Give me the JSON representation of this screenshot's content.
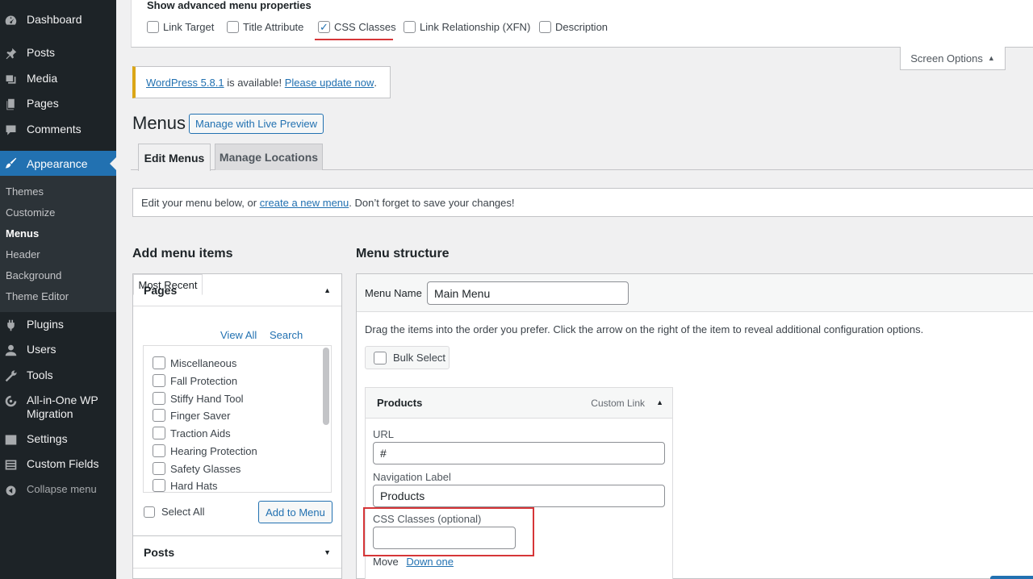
{
  "sidebar": {
    "items": [
      {
        "label": "Dashboard",
        "icon": "dashboard-icon"
      },
      {
        "label": "Posts",
        "icon": "pin-icon"
      },
      {
        "label": "Media",
        "icon": "media-icon"
      },
      {
        "label": "Pages",
        "icon": "pages-icon"
      },
      {
        "label": "Comments",
        "icon": "comments-icon"
      },
      {
        "label": "Appearance",
        "icon": "brush-icon"
      },
      {
        "label": "Plugins",
        "icon": "plugin-icon"
      },
      {
        "label": "Users",
        "icon": "user-icon"
      },
      {
        "label": "Tools",
        "icon": "wrench-icon"
      },
      {
        "label": "All-in-One WP",
        "label2": "Migration",
        "icon": "migration-icon"
      },
      {
        "label": "Settings",
        "icon": "settings-icon"
      },
      {
        "label": "Custom Fields",
        "icon": "fields-icon"
      }
    ],
    "submenu": [
      "Themes",
      "Customize",
      "Menus",
      "Header",
      "Background",
      "Theme Editor"
    ],
    "collapse_label": "Collapse menu"
  },
  "screen_options": {
    "legend": "Show advanced menu properties",
    "options": [
      {
        "label": "Link Target",
        "checked": false
      },
      {
        "label": "Title Attribute",
        "checked": false
      },
      {
        "label": "CSS Classes",
        "checked": true
      },
      {
        "label": "Link Relationship (XFN)",
        "checked": false
      },
      {
        "label": "Description",
        "checked": false
      }
    ],
    "tab_label": "Screen Options"
  },
  "update_notice": {
    "link1": "WordPress 5.8.1",
    "text": " is available! ",
    "link2": "Please update now",
    "end": "."
  },
  "page": {
    "title": "Menus",
    "live_preview": "Manage with Live Preview",
    "tabs": [
      "Edit Menus",
      "Manage Locations"
    ],
    "notice_pre": "Edit your menu below, or ",
    "notice_link": "create a new menu",
    "notice_post": ". Don’t forget to save your changes!"
  },
  "add_items": {
    "heading": "Add menu items",
    "pages_title": "Pages",
    "tabs": [
      "Most Recent",
      "View All",
      "Search"
    ],
    "pages": [
      "Miscellaneous",
      "Fall Protection",
      "Stiffy Hand Tool",
      "Finger Saver",
      "Traction Aids",
      "Hearing Protection",
      "Safety Glasses",
      "Hard Hats"
    ],
    "select_all": "Select All",
    "add_button": "Add to Menu",
    "posts_title": "Posts"
  },
  "menu_structure": {
    "heading": "Menu structure",
    "name_label": "Menu Name",
    "name_value": "Main Menu",
    "hint": "Drag the items into the order you prefer. Click the arrow on the right of the item to reveal additional configuration options.",
    "bulk_select": "Bulk Select",
    "item": {
      "title": "Products",
      "type": "Custom Link",
      "url_label": "URL",
      "url_value": "#",
      "nav_label": "Navigation Label",
      "nav_value": "Products",
      "css_label": "CSS Classes (optional)",
      "css_value": "",
      "move_label": "Move",
      "move_link": "Down one"
    }
  },
  "colors": {
    "accent": "#2271b1",
    "sidebar": "#1d2327",
    "highlight": "#d63638",
    "notice": "#dba617"
  }
}
